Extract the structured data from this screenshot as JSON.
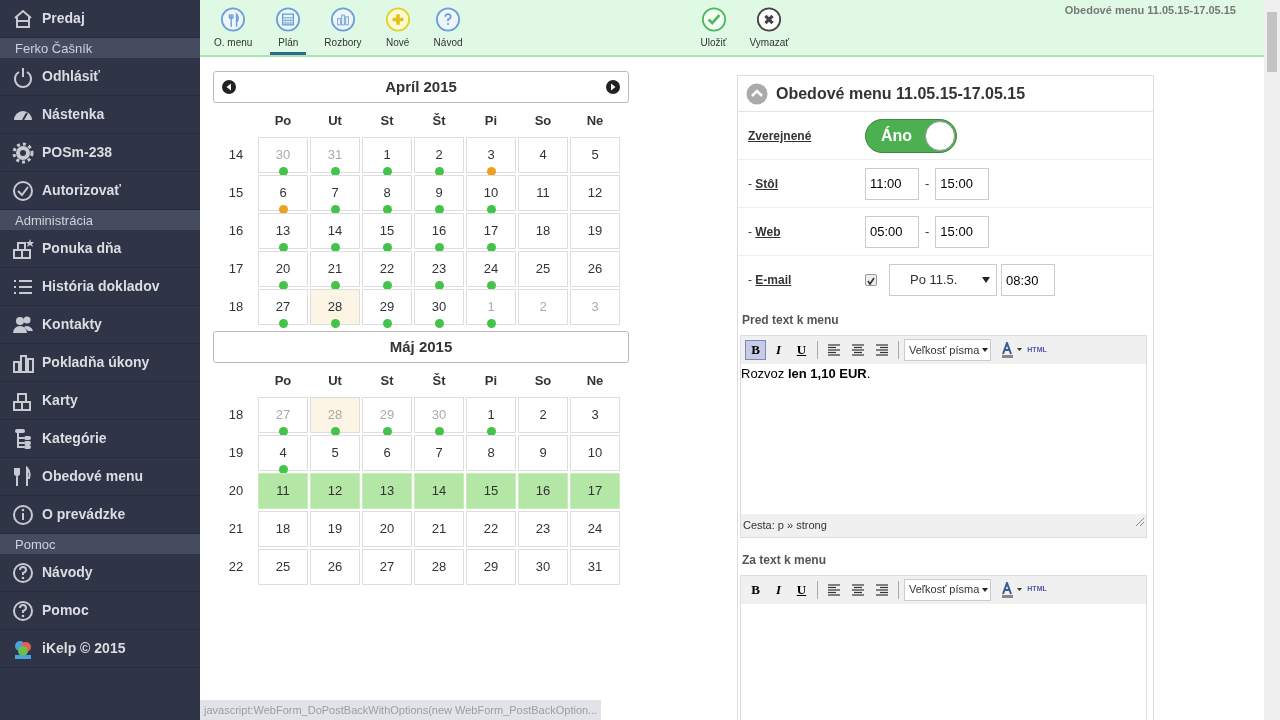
{
  "sidebar": {
    "items": [
      {
        "kind": "item",
        "label": "Predaj"
      },
      {
        "kind": "header",
        "label": "Ferko Čašník"
      },
      {
        "kind": "item",
        "label": "Odhlásiť"
      },
      {
        "kind": "item",
        "label": "Nástenka"
      },
      {
        "kind": "item",
        "label": "POSm-238"
      },
      {
        "kind": "item",
        "label": "Autorizovať"
      },
      {
        "kind": "header",
        "label": "Administrácia"
      },
      {
        "kind": "item",
        "label": "Ponuka dňa"
      },
      {
        "kind": "item",
        "label": "História dokladov"
      },
      {
        "kind": "item",
        "label": "Kontakty"
      },
      {
        "kind": "item",
        "label": "Pokladňa úkony"
      },
      {
        "kind": "item",
        "label": "Karty"
      },
      {
        "kind": "item",
        "label": "Kategórie"
      },
      {
        "kind": "item",
        "label": "Obedové menu"
      },
      {
        "kind": "item",
        "label": "O prevádzke"
      },
      {
        "kind": "header",
        "label": "Pomoc"
      },
      {
        "kind": "item",
        "label": "Návody"
      },
      {
        "kind": "item",
        "label": "Pomoc"
      },
      {
        "kind": "item",
        "label": "iKelp © 2015"
      }
    ]
  },
  "toolbar": {
    "tabs": [
      {
        "label": "O. menu",
        "selected": false
      },
      {
        "label": "Plán",
        "selected": true
      },
      {
        "label": "Rozbory",
        "selected": false
      },
      {
        "label": "Nové",
        "selected": false
      },
      {
        "label": "Návod",
        "selected": false
      }
    ],
    "actions": [
      {
        "label": "Uložiť"
      },
      {
        "label": "Vymazať"
      }
    ],
    "title": "Obedové menu 11.05.15-17.05.15"
  },
  "calendars": [
    {
      "title": "Apríl 2015",
      "weekdays": [
        "Po",
        "Ut",
        "St",
        "Št",
        "Pi",
        "So",
        "Ne"
      ],
      "weeks": [
        {
          "number": "14",
          "days": [
            {
              "day": "30",
              "muted": true,
              "color": "#44c34a"
            },
            {
              "day": "31",
              "muted": true,
              "color": "#44c34a"
            },
            {
              "day": "1",
              "color": "#44c34a"
            },
            {
              "day": "2",
              "color": "#44c34a"
            },
            {
              "day": "3",
              "color": "#f0a020"
            },
            {
              "day": "4"
            },
            {
              "day": "5"
            }
          ]
        },
        {
          "number": "15",
          "days": [
            {
              "day": "6",
              "color": "#f0a020"
            },
            {
              "day": "7",
              "color": "#44c34a"
            },
            {
              "day": "8",
              "color": "#44c34a"
            },
            {
              "day": "9",
              "color": "#44c34a"
            },
            {
              "day": "10",
              "color": "#44c34a"
            },
            {
              "day": "11"
            },
            {
              "day": "12"
            }
          ]
        },
        {
          "number": "16",
          "days": [
            {
              "day": "13",
              "color": "#44c34a"
            },
            {
              "day": "14",
              "color": "#44c34a"
            },
            {
              "day": "15",
              "color": "#44c34a"
            },
            {
              "day": "16",
              "color": "#44c34a"
            },
            {
              "day": "17",
              "color": "#44c34a"
            },
            {
              "day": "18"
            },
            {
              "day": "19"
            }
          ]
        },
        {
          "number": "17",
          "days": [
            {
              "day": "20",
              "color": "#44c34a"
            },
            {
              "day": "21",
              "color": "#44c34a"
            },
            {
              "day": "22",
              "color": "#44c34a"
            },
            {
              "day": "23",
              "color": "#44c34a"
            },
            {
              "day": "24",
              "color": "#44c34a"
            },
            {
              "day": "25"
            },
            {
              "day": "26"
            }
          ]
        },
        {
          "number": "18",
          "days": [
            {
              "day": "27",
              "color": "#44c34a"
            },
            {
              "day": "28",
              "today": true,
              "color": "#44c34a"
            },
            {
              "day": "29",
              "color": "#44c34a"
            },
            {
              "day": "30",
              "color": "#44c34a"
            },
            {
              "day": "1",
              "muted": true,
              "color": "#44c34a"
            },
            {
              "day": "2",
              "muted": true
            },
            {
              "day": "3",
              "muted": true
            }
          ]
        }
      ]
    },
    {
      "title": "Máj 2015",
      "weekdays": [
        "Po",
        "Ut",
        "St",
        "Št",
        "Pi",
        "So",
        "Ne"
      ],
      "weeks": [
        {
          "number": "18",
          "days": [
            {
              "day": "27",
              "muted": true,
              "color": "#44c34a"
            },
            {
              "day": "28",
              "muted": true,
              "today": true,
              "color": "#44c34a"
            },
            {
              "day": "29",
              "muted": true,
              "color": "#44c34a"
            },
            {
              "day": "30",
              "muted": true,
              "color": "#44c34a"
            },
            {
              "day": "1",
              "color": "#44c34a"
            },
            {
              "day": "2"
            },
            {
              "day": "3"
            }
          ]
        },
        {
          "number": "19",
          "days": [
            {
              "day": "4",
              "color": "#44c34a"
            },
            {
              "day": "5"
            },
            {
              "day": "6"
            },
            {
              "day": "7"
            },
            {
              "day": "8"
            },
            {
              "day": "9"
            },
            {
              "day": "10"
            }
          ]
        },
        {
          "number": "20",
          "days": [
            {
              "day": "11",
              "selected": true
            },
            {
              "day": "12",
              "selected": true
            },
            {
              "day": "13",
              "selected": true
            },
            {
              "day": "14",
              "selected": true
            },
            {
              "day": "15",
              "selected": true
            },
            {
              "day": "16",
              "selected": true
            },
            {
              "day": "17",
              "selected": true
            }
          ]
        },
        {
          "number": "21",
          "days": [
            {
              "day": "18"
            },
            {
              "day": "19"
            },
            {
              "day": "20"
            },
            {
              "day": "21"
            },
            {
              "day": "22"
            },
            {
              "day": "23"
            },
            {
              "day": "24"
            }
          ]
        },
        {
          "number": "22",
          "days": [
            {
              "day": "25"
            },
            {
              "day": "26"
            },
            {
              "day": "27"
            },
            {
              "day": "28"
            },
            {
              "day": "29"
            },
            {
              "day": "30"
            },
            {
              "day": "31"
            }
          ]
        }
      ]
    }
  ],
  "panel": {
    "title": "Obedové menu 11.05.15-17.05.15",
    "expanded": true,
    "published": {
      "label": "Zverejnené",
      "on": true,
      "text": "Áno"
    },
    "times": [
      {
        "prefix": "-",
        "label": "Stôl",
        "from": "11:00",
        "separator": "-",
        "to": "15:00"
      },
      {
        "prefix": "-",
        "label": "Web",
        "from": "05:00",
        "separator": "-",
        "to": "15:00"
      }
    ],
    "email": {
      "prefix": "-",
      "label": "E-mail",
      "checked": true,
      "day": "Po 11.5.",
      "time": "08:30"
    },
    "editors": [
      {
        "label": "Pred text k menu",
        "buttons": [
          "B",
          "I",
          "U"
        ],
        "bold_active": true,
        "font_size": "Veľkosť písma",
        "html": "HTML",
        "content": "Rozvoz **len 1,10 EUR**.",
        "path": "Cesta: p » strong"
      },
      {
        "label": "Za text k menu",
        "buttons": [
          "B",
          "I",
          "U"
        ],
        "bold_active": false,
        "font_size": "Veľkosť písma",
        "html": "HTML"
      }
    ]
  },
  "status_bar": "javascript:WebForm_DoPostBackWithOptions(new WebForm_PostBackOption..."
}
